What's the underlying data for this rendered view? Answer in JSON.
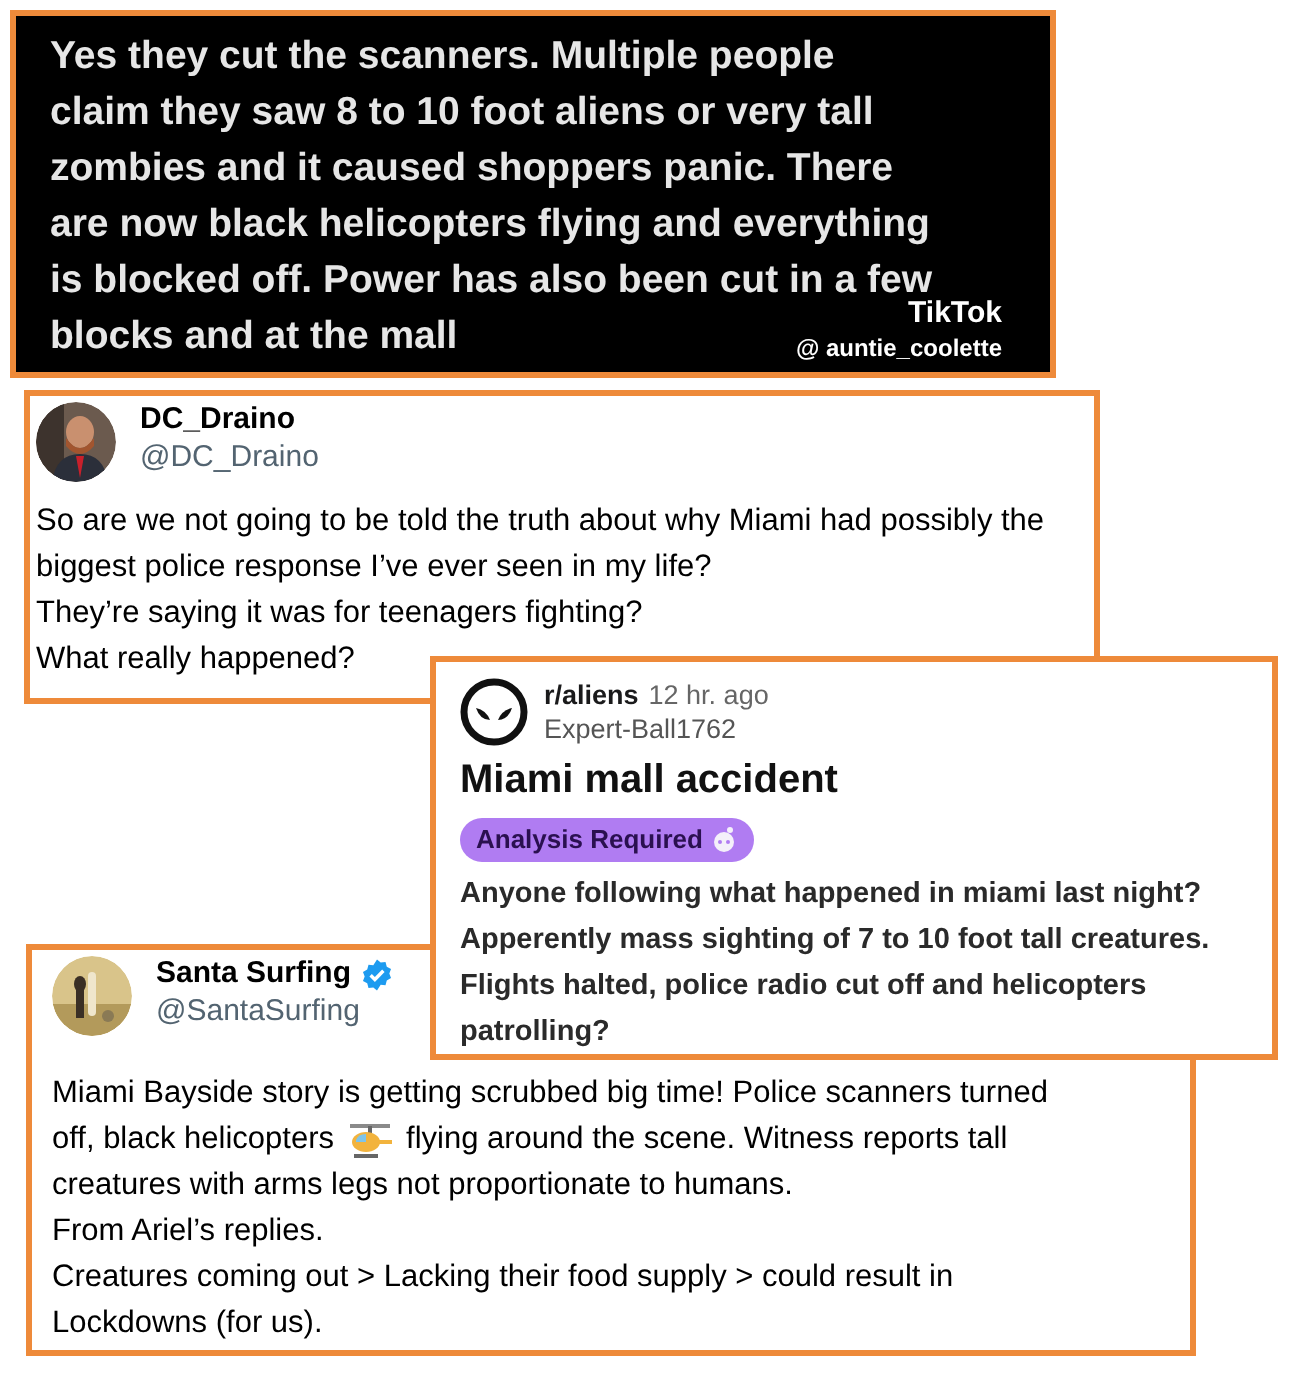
{
  "tiktok": {
    "lines": [
      "Yes they cut the scanners. Multiple people",
      "claim they saw 8 to 10 foot aliens or very tall",
      "zombies and it caused shoppers panic. There",
      "are now black helicopters flying and everything",
      "is blocked off. Power has also been cut in a few",
      "blocks and at the mall"
    ],
    "brand": "TikTok",
    "handle": "@ auntie_coolette"
  },
  "tweet_1": {
    "name": "DC_Draino",
    "handle": "@DC_Draino",
    "paragraphs": [
      "So are we not going to be told the truth about why Miami had possibly the biggest police response I’ve ever seen in my life?",
      "They’re saying it was for teenagers fighting?",
      "What really happened?"
    ]
  },
  "reddit": {
    "subreddit": "r/aliens",
    "time": "12 hr. ago",
    "user": "Expert-Ball1762",
    "title": "Miami mall accident",
    "flair": "Analysis Required",
    "body": "Anyone following what happened in miami last night? Apperently mass sighting of 7 to 10 foot tall creatures. Flights halted, police radio cut off and helicopters patrolling?"
  },
  "tweet_2": {
    "name": "Santa Surfing",
    "handle": "@SantaSurfing",
    "verified": true,
    "lines": [
      {
        "kind": "text",
        "text": "Miami Bayside story is getting scrubbed big time! Police scanners turned"
      },
      {
        "kind": "emoji",
        "before": "off, black helicopters",
        "after": "flying around the scene. Witness reports tall"
      },
      {
        "kind": "text",
        "text": "creatures with arms legs not proportionate to humans."
      },
      {
        "kind": "text",
        "text": "From Ariel’s replies."
      },
      {
        "kind": "text",
        "text": "Creatures coming out > Lacking their food supply > could result in"
      },
      {
        "kind": "text",
        "text": "Lockdowns (for us)."
      }
    ]
  }
}
